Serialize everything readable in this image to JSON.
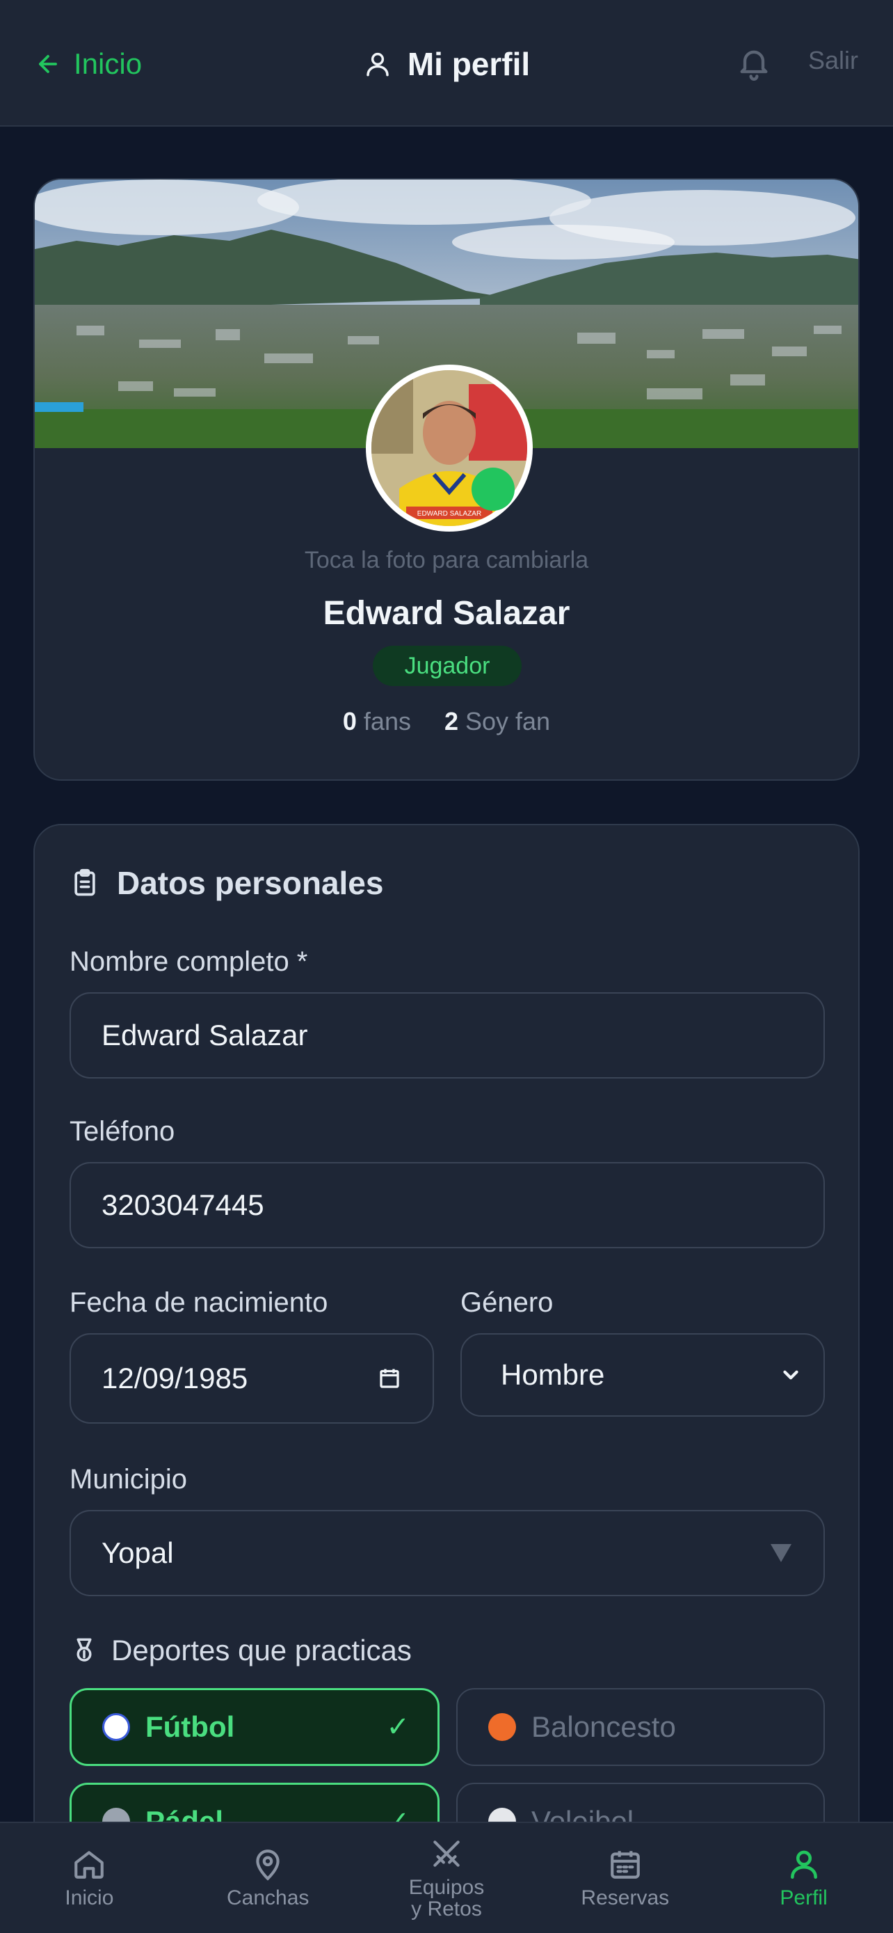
{
  "header": {
    "back_label": "Inicio",
    "title": "Mi perfil",
    "logout_label": "Salir"
  },
  "profile": {
    "photo_hint": "Toca la foto para cambiarla",
    "name": "Edward Salazar",
    "role": "Jugador",
    "fans_count": "0",
    "fans_label": "fans",
    "soy_fan_count": "2",
    "soy_fan_label": "Soy fan",
    "avatar_caption": "EDWARD SALAZAR"
  },
  "personal": {
    "section_title": "Datos personales",
    "name_label": "Nombre completo *",
    "name_value": "Edward Salazar",
    "phone_label": "Teléfono",
    "phone_value": "3203047445",
    "birth_label": "Fecha de nacimiento",
    "birth_value": "12/09/1985",
    "gender_label": "Género",
    "gender_value": "Hombre",
    "municipality_label": "Municipio",
    "municipality_value": "Yopal",
    "sports_title": "Deportes que practicas",
    "sports": [
      {
        "label": "Fútbol",
        "selected": true,
        "icon": "soccer-ball-icon"
      },
      {
        "label": "Baloncesto",
        "selected": false,
        "icon": "basketball-icon"
      },
      {
        "label": "Pádel",
        "selected": true,
        "icon": "padel-icon"
      },
      {
        "label": "Voleibol",
        "selected": false,
        "icon": "volleyball-icon"
      }
    ],
    "check_mark": "✓"
  },
  "nav": {
    "items": [
      {
        "label": "Inicio",
        "icon": "home-icon"
      },
      {
        "label": "Canchas",
        "icon": "map-pin-icon"
      },
      {
        "label_line1": "Equipos",
        "label_line2": "y Retos",
        "icon": "crossed-swords-icon"
      },
      {
        "label": "Reservas",
        "icon": "calendar-icon"
      },
      {
        "label": "Perfil",
        "icon": "user-icon"
      }
    ]
  },
  "colors": {
    "accent": "#22c55e",
    "background": "#0f1729",
    "card": "#1e2636"
  }
}
